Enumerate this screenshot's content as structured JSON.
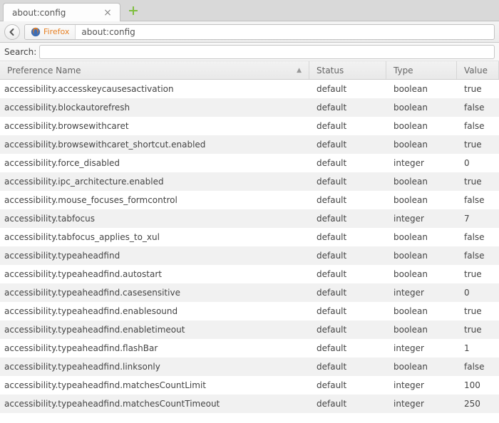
{
  "tab": {
    "title": "about:config"
  },
  "navbar": {
    "identity_label": "Firefox",
    "url": "about:config"
  },
  "search": {
    "label": "Search:",
    "value": ""
  },
  "columns": {
    "name": "Preference Name",
    "status": "Status",
    "type": "Type",
    "value": "Value"
  },
  "rows": [
    {
      "name": "accessibility.accesskeycausesactivation",
      "status": "default",
      "type": "boolean",
      "value": "true"
    },
    {
      "name": "accessibility.blockautorefresh",
      "status": "default",
      "type": "boolean",
      "value": "false"
    },
    {
      "name": "accessibility.browsewithcaret",
      "status": "default",
      "type": "boolean",
      "value": "false"
    },
    {
      "name": "accessibility.browsewithcaret_shortcut.enabled",
      "status": "default",
      "type": "boolean",
      "value": "true"
    },
    {
      "name": "accessibility.force_disabled",
      "status": "default",
      "type": "integer",
      "value": "0"
    },
    {
      "name": "accessibility.ipc_architecture.enabled",
      "status": "default",
      "type": "boolean",
      "value": "true"
    },
    {
      "name": "accessibility.mouse_focuses_formcontrol",
      "status": "default",
      "type": "boolean",
      "value": "false"
    },
    {
      "name": "accessibility.tabfocus",
      "status": "default",
      "type": "integer",
      "value": "7"
    },
    {
      "name": "accessibility.tabfocus_applies_to_xul",
      "status": "default",
      "type": "boolean",
      "value": "false"
    },
    {
      "name": "accessibility.typeaheadfind",
      "status": "default",
      "type": "boolean",
      "value": "false"
    },
    {
      "name": "accessibility.typeaheadfind.autostart",
      "status": "default",
      "type": "boolean",
      "value": "true"
    },
    {
      "name": "accessibility.typeaheadfind.casesensitive",
      "status": "default",
      "type": "integer",
      "value": "0"
    },
    {
      "name": "accessibility.typeaheadfind.enablesound",
      "status": "default",
      "type": "boolean",
      "value": "true"
    },
    {
      "name": "accessibility.typeaheadfind.enabletimeout",
      "status": "default",
      "type": "boolean",
      "value": "true"
    },
    {
      "name": "accessibility.typeaheadfind.flashBar",
      "status": "default",
      "type": "integer",
      "value": "1"
    },
    {
      "name": "accessibility.typeaheadfind.linksonly",
      "status": "default",
      "type": "boolean",
      "value": "false"
    },
    {
      "name": "accessibility.typeaheadfind.matchesCountLimit",
      "status": "default",
      "type": "integer",
      "value": "100"
    },
    {
      "name": "accessibility.typeaheadfind.matchesCountTimeout",
      "status": "default",
      "type": "integer",
      "value": "250"
    }
  ]
}
